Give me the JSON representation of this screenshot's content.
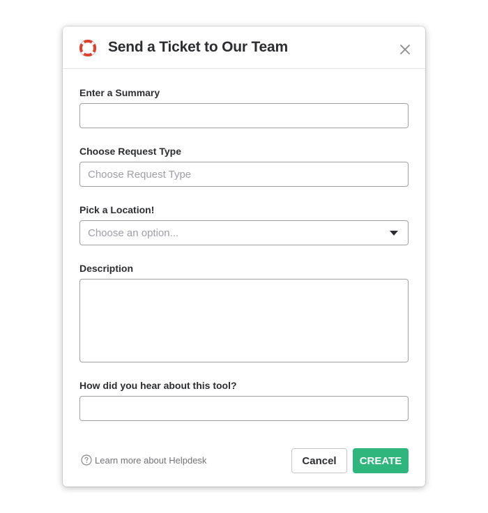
{
  "dialog": {
    "title": "Send a Ticket to Our Team",
    "header_icon": "lifebuoy-icon",
    "close_icon": "close-icon"
  },
  "fields": {
    "summary": {
      "label": "Enter a Summary",
      "value": "",
      "placeholder": ""
    },
    "request_type": {
      "label": "Choose Request Type",
      "value": "",
      "placeholder": "Choose Request Type"
    },
    "location": {
      "label": "Pick a Location!",
      "selected": "Choose an option..."
    },
    "description": {
      "label": "Description",
      "value": ""
    },
    "heard_about": {
      "label": "How did you hear about this tool?",
      "value": ""
    }
  },
  "footer": {
    "help_link": "Learn more about Helpdesk",
    "help_icon": "question-circle-icon",
    "cancel_label": "Cancel",
    "create_label": "CREATE"
  },
  "colors": {
    "accent_red": "#e0412d",
    "create_green": "#2eb67d"
  }
}
